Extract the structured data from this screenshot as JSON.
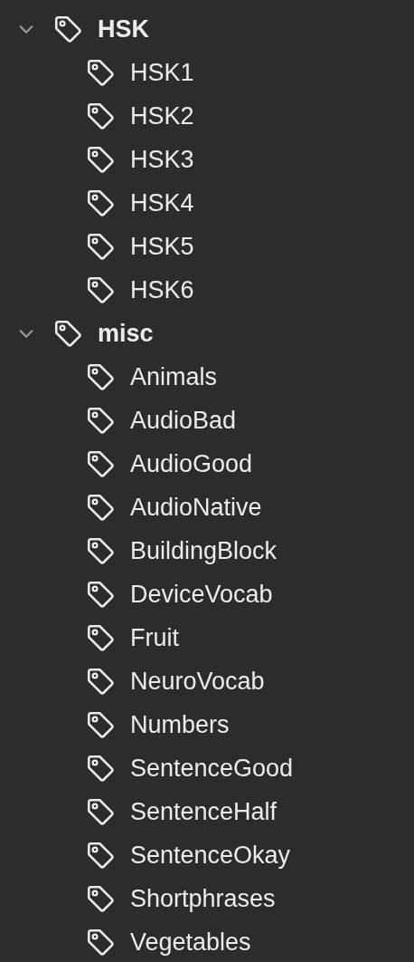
{
  "groups": [
    {
      "label": "HSK",
      "expanded": true,
      "children": [
        {
          "label": "HSK1"
        },
        {
          "label": "HSK2"
        },
        {
          "label": "HSK3"
        },
        {
          "label": "HSK4"
        },
        {
          "label": "HSK5"
        },
        {
          "label": "HSK6"
        }
      ]
    },
    {
      "label": "misc",
      "expanded": true,
      "children": [
        {
          "label": "Animals"
        },
        {
          "label": "AudioBad"
        },
        {
          "label": "AudioGood"
        },
        {
          "label": "AudioNative"
        },
        {
          "label": "BuildingBlock"
        },
        {
          "label": "DeviceVocab"
        },
        {
          "label": "Fruit"
        },
        {
          "label": "NeuroVocab"
        },
        {
          "label": "Numbers"
        },
        {
          "label": "SentenceGood"
        },
        {
          "label": "SentenceHalf"
        },
        {
          "label": "SentenceOkay"
        },
        {
          "label": "Shortphrases"
        },
        {
          "label": "Vegetables"
        }
      ]
    }
  ]
}
